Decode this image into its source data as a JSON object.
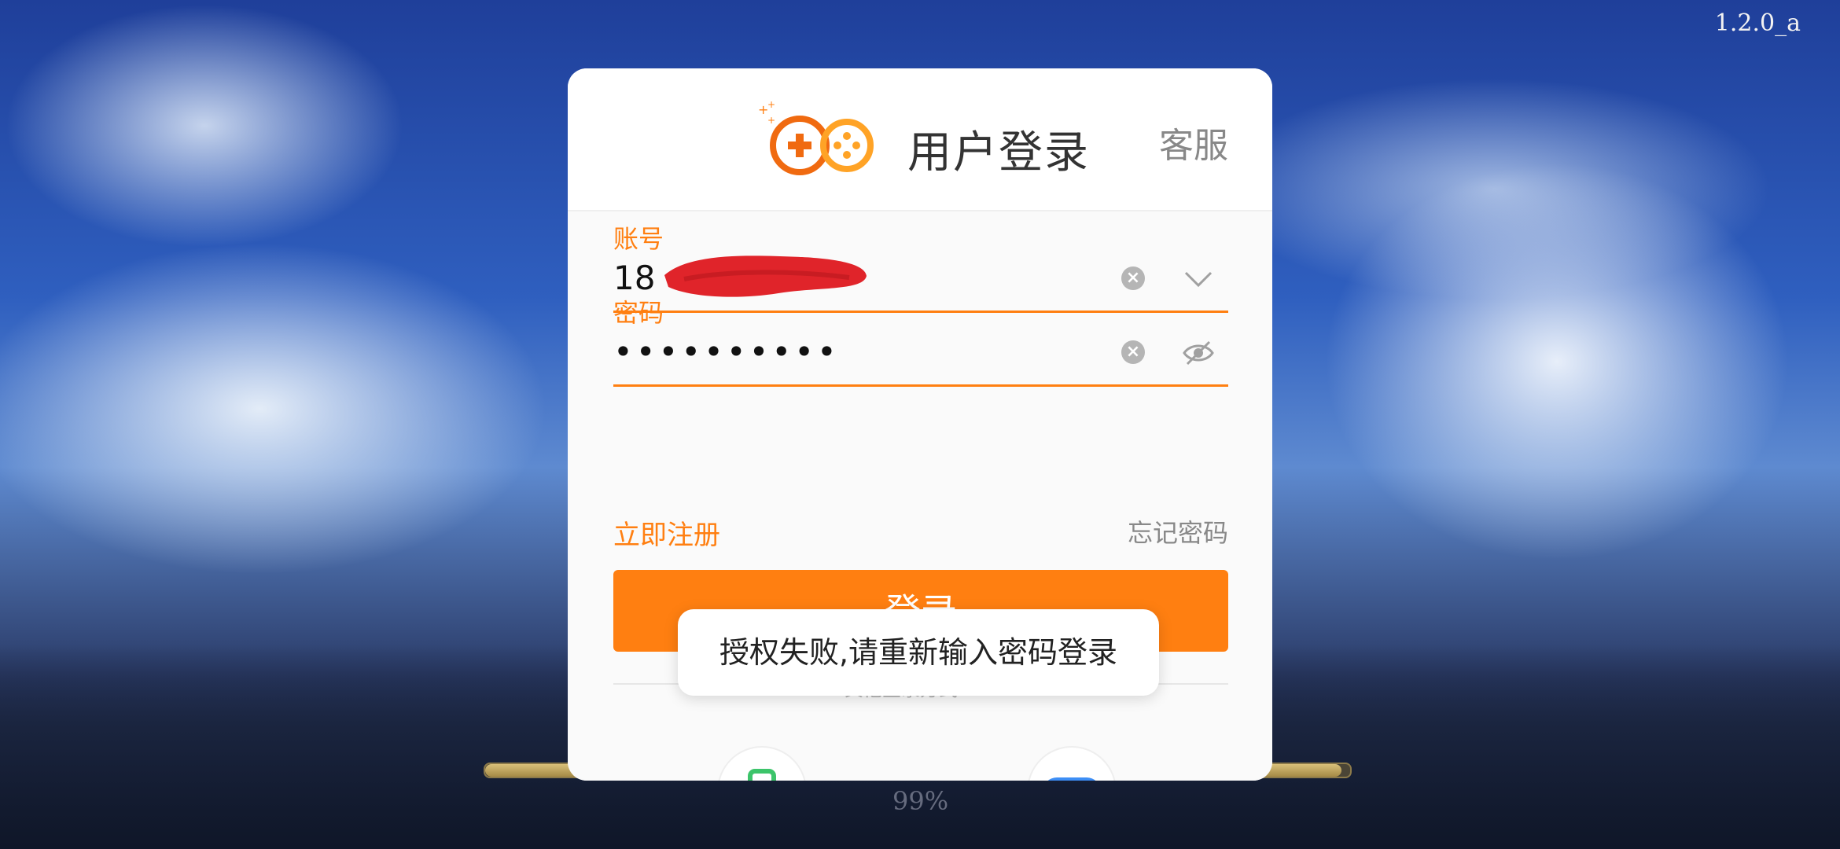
{
  "app": {
    "version": "1.2.0_a",
    "loading_percent": "99%",
    "loading_progress": 0.99
  },
  "dialog": {
    "title": "用户登录",
    "service_label": "客服",
    "account": {
      "label": "账号",
      "value": "18"
    },
    "password": {
      "label": "密码",
      "masked_value": "••••••••••"
    },
    "register_label": "立即注册",
    "forgot_label": "忘记密码",
    "login_label": "登录",
    "alt_login_text": "其他登录方式"
  },
  "toast": {
    "message": "授权失败,请重新输入密码登录"
  },
  "colors": {
    "accent": "#ff7f11",
    "phone_icon": "#3cc46a",
    "gamepad_icon": "#3d8ef5"
  }
}
